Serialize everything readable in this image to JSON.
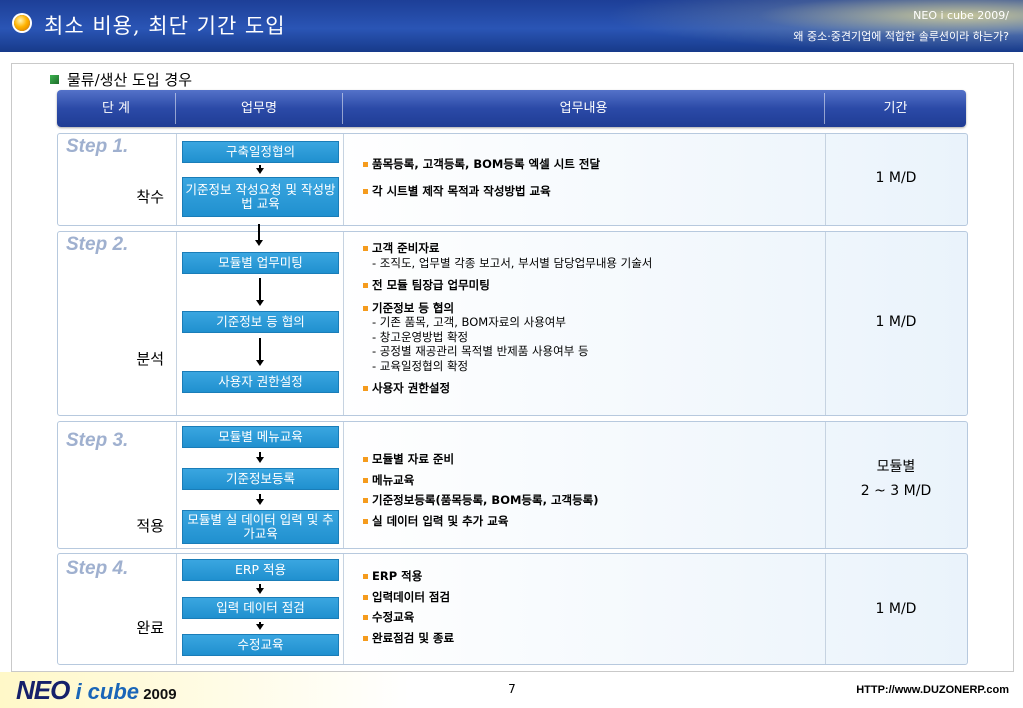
{
  "header": {
    "title": "최소 비용, 최단 기간 도입",
    "brand": "NEO i cube 2009/",
    "subtitle": "왜 중소·중견기업에 적합한 솔루션이라 하는가?"
  },
  "section": {
    "title": "물류/생산 도입 경우"
  },
  "table": {
    "columns": [
      "단 계",
      "업무명",
      "업무내용",
      "기간"
    ],
    "rows": [
      {
        "step": "Step 1.",
        "phase": "착수",
        "tasks": [
          "구축일정협의",
          "기준정보 작성요청 및 작성방법 교육"
        ],
        "items": [
          {
            "text": "품목등록, 고객등록, BOM등록 엑셀 시트 전달",
            "subs": []
          },
          {
            "text": "각 시트별 제작 목적과 작성방법 교육",
            "subs": []
          }
        ],
        "period": [
          "1 M/D"
        ]
      },
      {
        "step": "Step 2.",
        "phase": "분석",
        "tasks": [
          "모듈별 업무미팅",
          "기준정보 등 협의",
          "사용자 권한설정"
        ],
        "items": [
          {
            "text": "고객 준비자료",
            "subs": [
              "- 조직도, 업무별 각종 보고서, 부서별 담당업무내용 기술서"
            ]
          },
          {
            "text": "전 모듈 팀장급 업무미팅",
            "subs": []
          },
          {
            "text": "기준정보 등 협의",
            "subs": [
              "- 기존 품목, 고객, BOM자료의 사용여부",
              "- 창고운영방법 확정",
              "- 공정별 재공관리 목적별 반제품 사용여부 등",
              "- 교육일정협의 확정"
            ]
          },
          {
            "text": "사용자 권한설정",
            "subs": []
          }
        ],
        "period": [
          "1 M/D"
        ]
      },
      {
        "step": "Step 3.",
        "phase": "적용",
        "tasks": [
          "모듈별 메뉴교육",
          "기준정보등록",
          "모듈별 실 데이터 입력 및 추가교육"
        ],
        "items": [
          {
            "text": "모듈별 자료 준비",
            "subs": []
          },
          {
            "text": "메뉴교육",
            "subs": []
          },
          {
            "text": "기준정보등록(품목등록, BOM등록, 고객등록)",
            "subs": []
          },
          {
            "text": "실 데이터 입력 및 추가 교육",
            "subs": []
          }
        ],
        "period": [
          "모듈별",
          "2 ~ 3 M/D"
        ]
      },
      {
        "step": "Step 4.",
        "phase": "완료",
        "tasks": [
          "ERP 적용",
          "입력 데이터 점검",
          "수정교육"
        ],
        "items": [
          {
            "text": "ERP 적용",
            "subs": []
          },
          {
            "text": "입력데이터 점검",
            "subs": []
          },
          {
            "text": "수정교육",
            "subs": []
          },
          {
            "text": "완료점검 및 종료",
            "subs": []
          }
        ],
        "period": [
          "1 M/D"
        ]
      }
    ]
  },
  "footer": {
    "logo_neo": "NEO",
    "logo_icube": " i cube",
    "logo_year": " 2009",
    "page": "7",
    "url": "HTTP://www.DUZONERP.com"
  },
  "colors": {
    "header_bg": "#2a55b5",
    "task_box": "#2b9ad8",
    "item_bullet": "#f59b1d",
    "step_label": "#9fb0cf"
  },
  "icons": [
    "orange-circle-bullet-icon",
    "green-square-icon",
    "orange-square-bullet-icon",
    "down-arrow-icon"
  ]
}
